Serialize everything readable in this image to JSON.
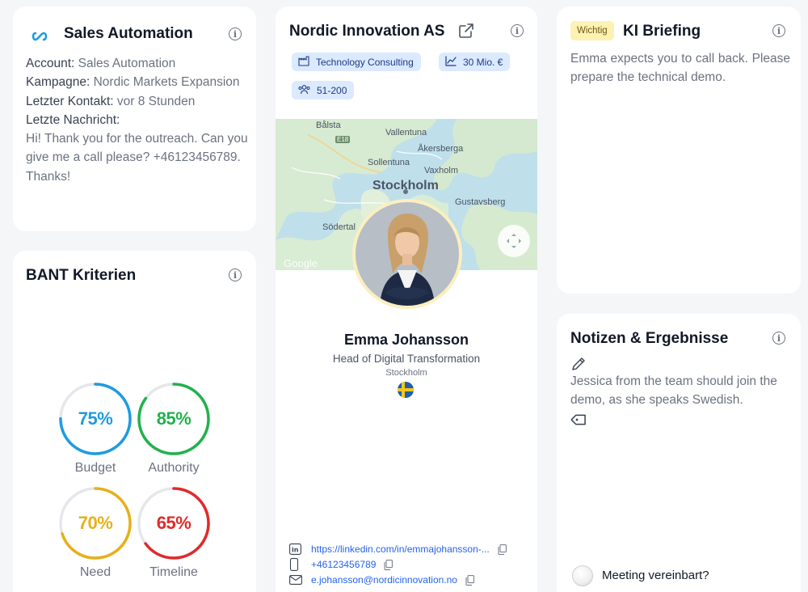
{
  "account_card": {
    "title": "Sales Automation",
    "account_label": "Account:",
    "account_value": "Sales Automation",
    "campaign_label": "Kampagne:",
    "campaign_value": "Nordic Markets Expansion",
    "last_contact_label": "Letzter Kontakt:",
    "last_contact_value": "vor 8 Stunden",
    "last_message_label": "Letzte Nachricht:",
    "last_message_value": "Hi! Thank you for the outreach. Can you give me a call please? +46123456789. Thanks!"
  },
  "bant": {
    "title": "BANT Kriterien",
    "criteria": [
      {
        "label": "Budget",
        "value": 75,
        "display": "75%",
        "color": "#1e9be0"
      },
      {
        "label": "Authority",
        "value": 85,
        "display": "85%",
        "color": "#22b14c"
      },
      {
        "label": "Need",
        "value": 70,
        "display": "70%",
        "color": "#e6b01a"
      },
      {
        "label": "Timeline",
        "value": 65,
        "display": "65%",
        "color": "#e02a2a"
      }
    ]
  },
  "company": {
    "name": "Nordic Innovation AS",
    "chips": {
      "industry": "Technology Consulting",
      "revenue": "30 Mio. €",
      "employees": "51-200"
    },
    "map": {
      "labels": {
        "balsta": "Bålsta",
        "vallentuna": "Vallentuna",
        "akersberga": "Åkersberga",
        "sollentuna": "Sollentuna",
        "vaxholm": "Vaxholm",
        "stockholm": "Stockholm",
        "gustavsberg": "Gustavsberg",
        "sodertalje": "Södertal",
        "road": "E18",
        "google": "Google"
      }
    }
  },
  "person": {
    "name": "Emma Johansson",
    "title": "Head of Digital Transformation",
    "city": "Stockholm",
    "linkedin": "https://linkedin.com/in/emmajohansson-...",
    "phone": "+46123456789",
    "email": "e.johansson@nordicinnovation.no"
  },
  "briefing": {
    "badge": "Wichtig",
    "title": "KI Briefing",
    "text": "Emma expects you to call back. Please prepare the technical demo."
  },
  "notes": {
    "title": "Notizen & Ergebnisse",
    "text": "Jessica from the team should join the demo, as she speaks Swedish.",
    "meeting_label": "Meeting vereinbart?"
  },
  "colors": {
    "chip_bg": "#dbeafe",
    "link": "#2563eb",
    "badge_bg": "#fdf2b3",
    "brand": "#1e9be0"
  },
  "icons": [
    "infinity-logo-icon",
    "info-icon",
    "external-link-icon",
    "factory-icon",
    "chart-icon",
    "users-icon",
    "linkedin-icon",
    "phone-icon",
    "mail-icon",
    "copy-icon",
    "pencil-icon",
    "tag-icon",
    "fullscreen-icon",
    "sweden-flag-icon"
  ]
}
